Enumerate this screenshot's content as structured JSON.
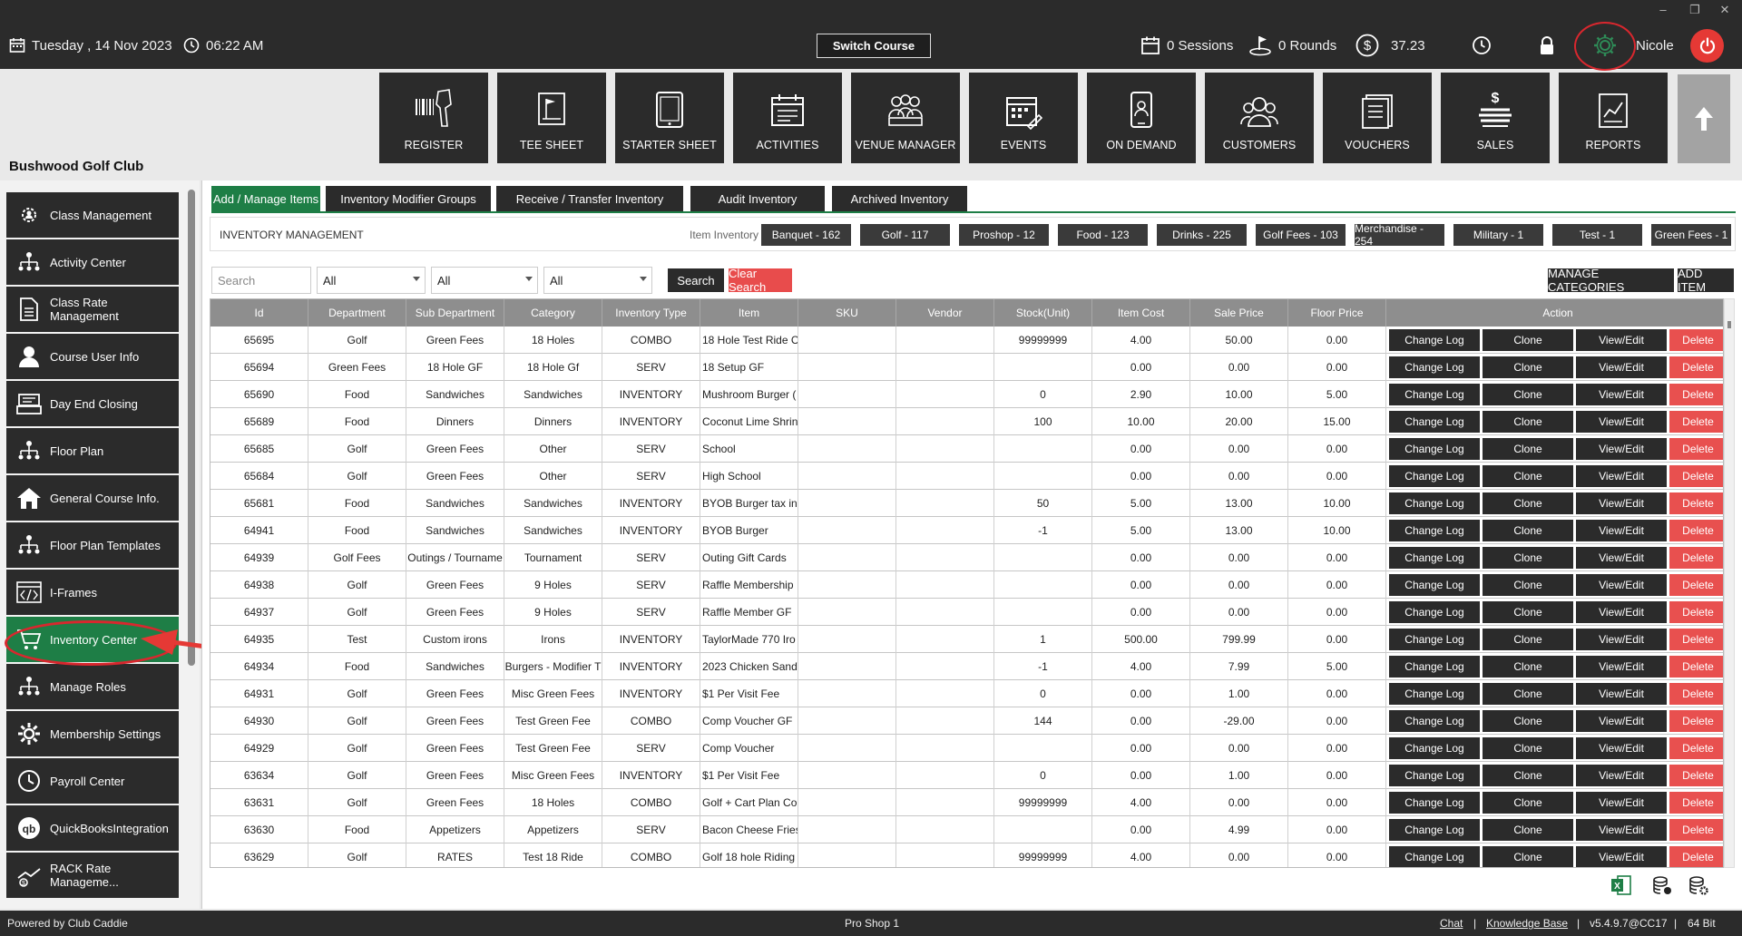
{
  "window": {
    "minimize": "–",
    "restore": "❐",
    "close": "✕"
  },
  "topbar": {
    "date": "Tuesday ,  14 Nov 2023",
    "time": "06:22 AM",
    "switch_course": "Switch Course",
    "sessions": "0 Sessions",
    "rounds": "0 Rounds",
    "balance": "37.23",
    "user": "Nicole"
  },
  "nav_tiles": [
    {
      "label": "REGISTER",
      "icon": "barcode-scanner-icon"
    },
    {
      "label": "TEE SHEET",
      "icon": "tee-sheet-icon"
    },
    {
      "label": "STARTER SHEET",
      "icon": "tablet-icon"
    },
    {
      "label": "ACTIVITIES",
      "icon": "activities-calendar-icon"
    },
    {
      "label": "VENUE MANAGER",
      "icon": "venue-people-icon"
    },
    {
      "label": "EVENTS",
      "icon": "events-calendar-icon"
    },
    {
      "label": "ON DEMAND",
      "icon": "phone-icon"
    },
    {
      "label": "CUSTOMERS",
      "icon": "customers-icon"
    },
    {
      "label": "VOUCHERS",
      "icon": "vouchers-icon"
    },
    {
      "label": "SALES",
      "icon": "sales-icon"
    },
    {
      "label": "REPORTS",
      "icon": "reports-icon"
    }
  ],
  "club_name": "Bushwood Golf Club",
  "sidebar": {
    "items": [
      {
        "label": "Class Management",
        "icon": "gear-people-icon"
      },
      {
        "label": "Activity  Center",
        "icon": "org-chart-icon"
      },
      {
        "label": "Class Rate Management",
        "icon": "document-icon"
      },
      {
        "label": "Course User Info",
        "icon": "user-icon"
      },
      {
        "label": "Day End Closing",
        "icon": "register-icon"
      },
      {
        "label": "Floor Plan",
        "icon": "org-chart-icon"
      },
      {
        "label": "General Course Info.",
        "icon": "home-icon"
      },
      {
        "label": "Floor Plan Templates",
        "icon": "org-chart-icon"
      },
      {
        "label": "I-Frames",
        "icon": "code-icon"
      },
      {
        "label": "Inventory Center",
        "icon": "cart-icon"
      },
      {
        "label": "Manage Roles",
        "icon": "org-chart-icon"
      },
      {
        "label": "Membership Settings",
        "icon": "gear-icon"
      },
      {
        "label": "Payroll Center",
        "icon": "clock-icon"
      },
      {
        "label": "QuickBooksIntegration",
        "icon": "quickbooks-icon"
      },
      {
        "label": "RACK Rate Manageme...",
        "icon": "rate-icon"
      }
    ]
  },
  "tabs": [
    "Add / Manage Items",
    "Inventory Modifier Groups",
    "Receive / Transfer Inventory",
    "Audit Inventory",
    "Archived Inventory"
  ],
  "inventory_header": {
    "title": "INVENTORY MANAGEMENT",
    "item_inventory_label": "Item Inventory",
    "categories": [
      "Banquet - 162",
      "Golf - 117",
      "Proshop - 12",
      "Food - 123",
      "Drinks - 225",
      "Golf Fees - 103",
      "Merchandise - 254",
      "Military - 1",
      "Test - 1",
      "Green Fees - 1"
    ]
  },
  "filters": {
    "search_placeholder": "Search",
    "department": "All",
    "sub_department": "All",
    "category": "All",
    "search_button": "Search",
    "clear_button": "Clear Search",
    "manage_categories": "MANAGE CATEGORIES",
    "add_item": "ADD ITEM"
  },
  "table": {
    "columns": [
      "Id",
      "Department",
      "Sub Department",
      "Category",
      "Inventory Type",
      "Item",
      "SKU",
      "Vendor",
      "Stock(Unit)",
      "Item Cost",
      "Sale Price",
      "Floor Price",
      "Action"
    ],
    "actions": [
      "Change Log",
      "Clone",
      "View/Edit",
      "Delete"
    ],
    "rows": [
      [
        "65695",
        "Golf",
        "Green Fees",
        "18 Holes",
        "COMBO",
        "18 Hole Test Ride C",
        "",
        "",
        "99999999",
        "4.00",
        "50.00",
        "0.00"
      ],
      [
        "65694",
        "Green Fees",
        "18 Hole GF",
        "18 Hole Gf",
        "SERV",
        "18 Setup GF",
        "",
        "",
        "",
        "0.00",
        "0.00",
        "0.00"
      ],
      [
        "65690",
        "Food",
        "Sandwiches",
        "Sandwiches",
        "INVENTORY",
        "Mushroom Burger (",
        "",
        "",
        "0",
        "2.90",
        "10.00",
        "5.00"
      ],
      [
        "65689",
        "Food",
        "Dinners",
        "Dinners",
        "INVENTORY",
        "Coconut Lime Shrin",
        "",
        "",
        "100",
        "10.00",
        "20.00",
        "15.00"
      ],
      [
        "65685",
        "Golf",
        "Green Fees",
        "Other",
        "SERV",
        "School",
        "",
        "",
        "",
        "0.00",
        "0.00",
        "0.00"
      ],
      [
        "65684",
        "Golf",
        "Green Fees",
        "Other",
        "SERV",
        "High School",
        "",
        "",
        "",
        "0.00",
        "0.00",
        "0.00"
      ],
      [
        "65681",
        "Food",
        "Sandwiches",
        "Sandwiches",
        "INVENTORY",
        "BYOB Burger tax inc",
        "",
        "",
        "50",
        "5.00",
        "13.00",
        "10.00"
      ],
      [
        "64941",
        "Food",
        "Sandwiches",
        "Sandwiches",
        "INVENTORY",
        "BYOB Burger",
        "",
        "",
        "-1",
        "5.00",
        "13.00",
        "10.00"
      ],
      [
        "64939",
        "Golf Fees",
        "Outings / Tourname",
        "Tournament",
        "SERV",
        "Outing Gift Cards",
        "",
        "",
        "",
        "0.00",
        "0.00",
        "0.00"
      ],
      [
        "64938",
        "Golf",
        "Green Fees",
        "9 Holes",
        "SERV",
        "Raffle Membership",
        "",
        "",
        "",
        "0.00",
        "0.00",
        "0.00"
      ],
      [
        "64937",
        "Golf",
        "Green Fees",
        "9 Holes",
        "SERV",
        "Raffle Member GF",
        "",
        "",
        "",
        "0.00",
        "0.00",
        "0.00"
      ],
      [
        "64935",
        "Test",
        "Custom irons",
        "Irons",
        "INVENTORY",
        "TaylorMade 770 Iro",
        "",
        "",
        "1",
        "500.00",
        "799.99",
        "0.00"
      ],
      [
        "64934",
        "Food",
        "Sandwiches",
        "Burgers - Modifier T",
        "INVENTORY",
        "2023 Chicken Sand\\",
        "",
        "",
        "-1",
        "4.00",
        "7.99",
        "5.00"
      ],
      [
        "64931",
        "Golf",
        "Green Fees",
        "Misc Green Fees",
        "INVENTORY",
        "$1 Per Visit Fee",
        "",
        "",
        "0",
        "0.00",
        "1.00",
        "0.00"
      ],
      [
        "64930",
        "Golf",
        "Green Fees",
        "Test Green Fee",
        "COMBO",
        "Comp Voucher GF",
        "",
        "",
        "144",
        "0.00",
        "-29.00",
        "0.00"
      ],
      [
        "64929",
        "Golf",
        "Green Fees",
        "Test Green Fee",
        "SERV",
        "Comp Voucher",
        "",
        "",
        "",
        "0.00",
        "0.00",
        "0.00"
      ],
      [
        "63634",
        "Golf",
        "Green Fees",
        "Misc Green Fees",
        "INVENTORY",
        "$1 Per Visit Fee",
        "",
        "",
        "0",
        "0.00",
        "1.00",
        "0.00"
      ],
      [
        "63631",
        "Golf",
        "Green Fees",
        "18 Holes",
        "COMBO",
        "Golf + Cart Plan Co",
        "",
        "",
        "99999999",
        "4.00",
        "0.00",
        "0.00"
      ],
      [
        "63630",
        "Food",
        "Appetizers",
        "Appetizers",
        "SERV",
        "Bacon Cheese Fries",
        "",
        "",
        "",
        "0.00",
        "4.99",
        "0.00"
      ],
      [
        "63629",
        "Golf",
        "RATES",
        "Test 18 Ride",
        "COMBO",
        "Golf 18 hole Riding",
        "",
        "",
        "99999999",
        "4.00",
        "0.00",
        "0.00"
      ]
    ]
  },
  "statusbar": {
    "powered_by": "Powered by Club Caddie",
    "station": "Pro Shop 1",
    "chat": "Chat",
    "sep1": "|",
    "knowledge_base": "Knowledge Base",
    "sep2": "|",
    "version": "v5.4.9.7@CC17",
    "sep3": "|",
    "arch": "64 Bit"
  },
  "colors": {
    "accent_green": "#1e7e46",
    "dark": "#2b2b2b",
    "delete_red": "#e8504f",
    "annotation_red": "#d9272e"
  }
}
